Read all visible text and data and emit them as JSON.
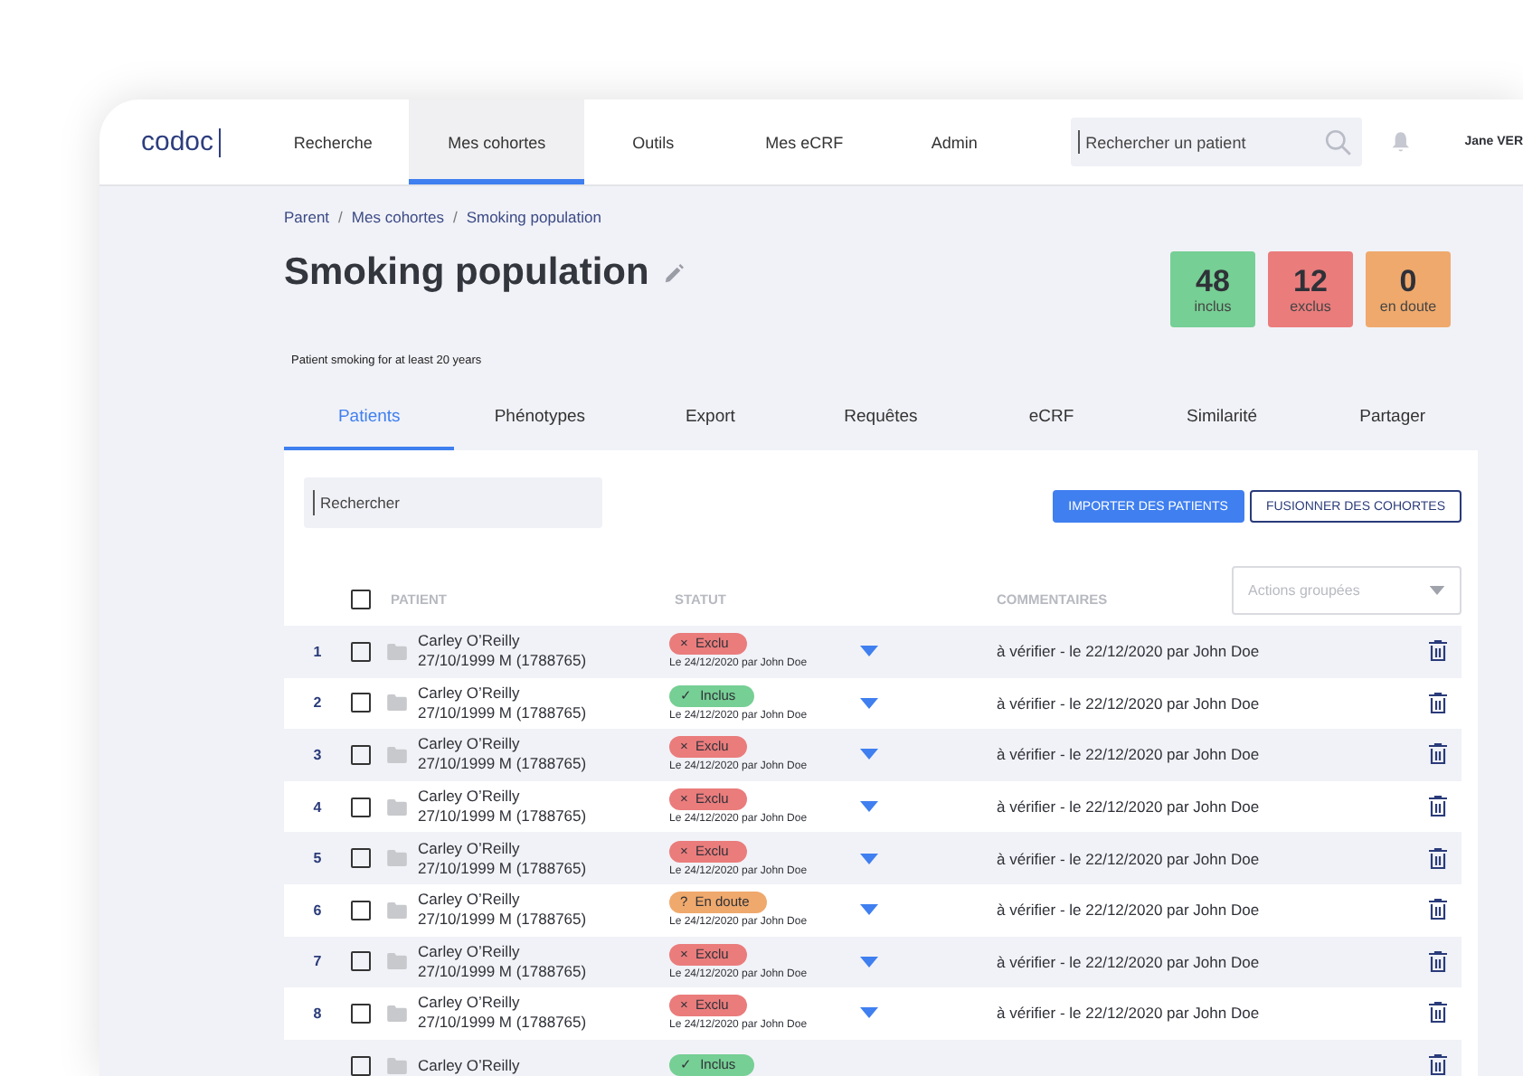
{
  "header": {
    "logo": "codoc",
    "nav": [
      {
        "label": "Recherche",
        "selected": false
      },
      {
        "label": "Mes cohortes",
        "selected": true
      },
      {
        "label": "Outils",
        "selected": false
      },
      {
        "label": "Mes eCRF",
        "selected": false
      },
      {
        "label": "Admin",
        "selected": false
      }
    ],
    "search": {
      "placeholder": "Rechercher un patient"
    },
    "user": "Jane VER"
  },
  "breadcrumb": [
    {
      "label": "Parent"
    },
    {
      "separator": "/",
      "label": "Mes cohortes"
    },
    {
      "separator": "/",
      "label": "Smoking population"
    }
  ],
  "title": "Smoking population",
  "description": "Patient smoking for at least 20 years",
  "counters": [
    {
      "kind": "included",
      "value": "48",
      "label": "inclus"
    },
    {
      "kind": "excluded",
      "value": "12",
      "label": "exclus"
    },
    {
      "kind": "doubt",
      "value": "0",
      "label": "en doute"
    }
  ],
  "tabs": [
    {
      "label": "Patients",
      "selected": true
    },
    {
      "label": "Phénotypes",
      "selected": false
    },
    {
      "label": "Export",
      "selected": false
    },
    {
      "label": "Requêtes",
      "selected": false
    },
    {
      "label": "eCRF",
      "selected": false
    },
    {
      "label": "Similarité",
      "selected": false
    },
    {
      "label": "Partager",
      "selected": false
    }
  ],
  "filter": {
    "placeholder": "Rechercher"
  },
  "buttons": [
    {
      "kind": "primary",
      "label": "IMPORTER DES PATIENTS"
    },
    {
      "kind": "outline",
      "label": "FUSIONNER DES COHORTES"
    }
  ],
  "bulk_actions": {
    "placeholder": "Actions groupées"
  },
  "table": {
    "columns": [
      "PATIENT",
      "STATUT",
      "COMMENTAIRES"
    ],
    "select_all": {
      "checked": false
    },
    "rows": [
      {
        "index": "1",
        "checked": false,
        "name": "Carley O’Reilly",
        "details": "27/10/1999 M (1788765)",
        "status": {
          "kind": "excluded",
          "symbol": "×",
          "label": "Exclu"
        },
        "status_note": "Le 24/12/2020 par John Doe",
        "comment": "à vérifier - le 22/12/2020 par John Doe"
      },
      {
        "index": "2",
        "checked": false,
        "name": "Carley O’Reilly",
        "details": "27/10/1999 M (1788765)",
        "status": {
          "kind": "included",
          "symbol": "✓",
          "label": "Inclus"
        },
        "status_note": "Le 24/12/2020 par John Doe",
        "comment": "à vérifier - le 22/12/2020 par John Doe"
      },
      {
        "index": "3",
        "checked": false,
        "name": "Carley O’Reilly",
        "details": "27/10/1999 M (1788765)",
        "status": {
          "kind": "excluded",
          "symbol": "×",
          "label": "Exclu"
        },
        "status_note": "Le 24/12/2020 par John Doe",
        "comment": "à vérifier - le 22/12/2020 par John Doe"
      },
      {
        "index": "4",
        "checked": false,
        "name": "Carley O’Reilly",
        "details": "27/10/1999 M (1788765)",
        "status": {
          "kind": "excluded",
          "symbol": "×",
          "label": "Exclu"
        },
        "status_note": "Le 24/12/2020 par John Doe",
        "comment": "à vérifier - le 22/12/2020 par John Doe"
      },
      {
        "index": "5",
        "checked": false,
        "name": "Carley O’Reilly",
        "details": "27/10/1999 M (1788765)",
        "status": {
          "kind": "excluded",
          "symbol": "×",
          "label": "Exclu"
        },
        "status_note": "Le 24/12/2020 par John Doe",
        "comment": "à vérifier - le 22/12/2020 par John Doe"
      },
      {
        "index": "6",
        "checked": false,
        "name": "Carley O’Reilly",
        "details": "27/10/1999 M (1788765)",
        "status": {
          "kind": "doubt",
          "symbol": "?",
          "label": "En doute"
        },
        "status_note": "Le 24/12/2020 par John Doe",
        "comment": "à vérifier - le 22/12/2020 par John Doe"
      },
      {
        "index": "7",
        "checked": false,
        "name": "Carley O’Reilly",
        "details": "27/10/1999 M (1788765)",
        "status": {
          "kind": "excluded",
          "symbol": "×",
          "label": "Exclu"
        },
        "status_note": "Le 24/12/2020 par John Doe",
        "comment": "à vérifier - le 22/12/2020 par John Doe"
      },
      {
        "index": "8",
        "checked": false,
        "name": "Carley O’Reilly",
        "details": "27/10/1999 M (1788765)",
        "status": {
          "kind": "excluded",
          "symbol": "×",
          "label": "Exclu"
        },
        "status_note": "Le 24/12/2020 par John Doe",
        "comment": "à vérifier - le 22/12/2020 par John Doe"
      },
      {
        "checked": false,
        "name": "Carley O’Reilly",
        "status": {
          "kind": "included",
          "symbol": "✓",
          "label": "Inclus"
        }
      }
    ]
  }
}
